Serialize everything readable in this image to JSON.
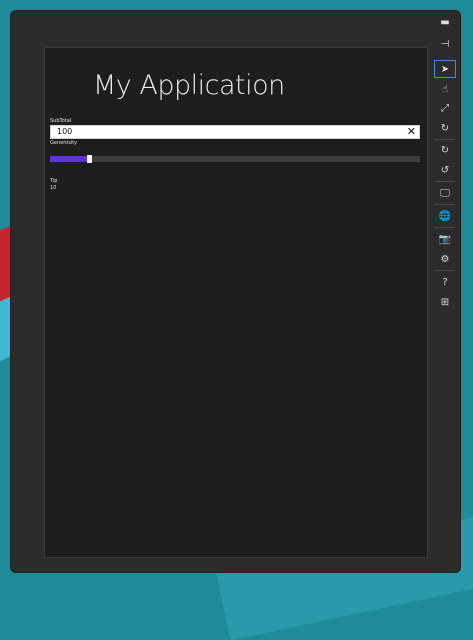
{
  "app": {
    "title": "My Application",
    "subtotal_label": "SubTotal",
    "subtotal_value": "100",
    "clear_glyph": "✕",
    "generosity_label": "Generosity",
    "generosity_level": 0.1,
    "tip_label": "Tip",
    "tip_value": "10"
  },
  "colors": {
    "slider_fill": "#5b33d6",
    "selected_border": "#3c8be5"
  },
  "toolbar": {
    "items": [
      {
        "icon": "minimize-icon",
        "glyph": "▬"
      },
      {
        "icon": "pin-icon",
        "glyph": "⊣"
      },
      {
        "icon": "mouse-pointer-icon",
        "glyph": "➤"
      },
      {
        "icon": "touch-icon",
        "glyph": "☝"
      },
      {
        "icon": "pinch-zoom-icon",
        "glyph": "⤢"
      },
      {
        "icon": "rotate-touch-icon",
        "glyph": "↻"
      },
      {
        "icon": "rotate-clockwise-icon",
        "glyph": "↻"
      },
      {
        "icon": "rotate-counterclockwise-icon",
        "glyph": "↺"
      },
      {
        "icon": "change-resolution-icon",
        "glyph": "🖵"
      },
      {
        "icon": "location-icon",
        "glyph": "🌐"
      },
      {
        "icon": "screenshot-icon",
        "glyph": "📷"
      },
      {
        "icon": "settings-icon",
        "glyph": "⚙"
      },
      {
        "icon": "help-icon",
        "glyph": "?"
      },
      {
        "icon": "windows-icon",
        "glyph": "⊞"
      }
    ]
  }
}
